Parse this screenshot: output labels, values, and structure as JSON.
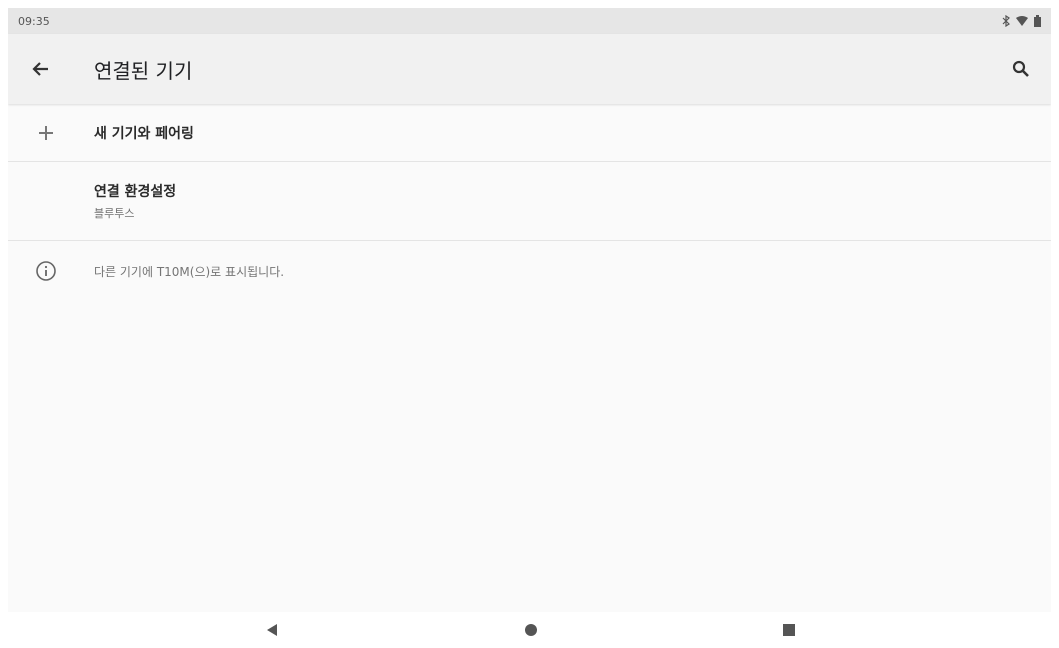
{
  "status_bar": {
    "time": "09:35",
    "icons": [
      "bluetooth-icon",
      "wifi-icon",
      "battery-icon"
    ]
  },
  "app_bar": {
    "title": "연결된 기기",
    "back_icon": "arrow-back-icon",
    "search_icon": "search-icon"
  },
  "list": {
    "pair_new": {
      "label": "새 기기와 페어링",
      "icon": "plus-icon"
    },
    "connection_prefs": {
      "label": "연결 환경설정",
      "summary": "블루투스"
    }
  },
  "info": {
    "icon": "info-icon",
    "text": "다른 기기에 T10M(으)로 표시됩니다."
  },
  "nav_bar": {
    "buttons": [
      "nav-back-icon",
      "nav-home-icon",
      "nav-recents-icon"
    ]
  },
  "colors": {
    "app_bar_bg": "#f1f1f1",
    "status_bar_bg": "#e6e6e6",
    "background": "#fafafa"
  }
}
